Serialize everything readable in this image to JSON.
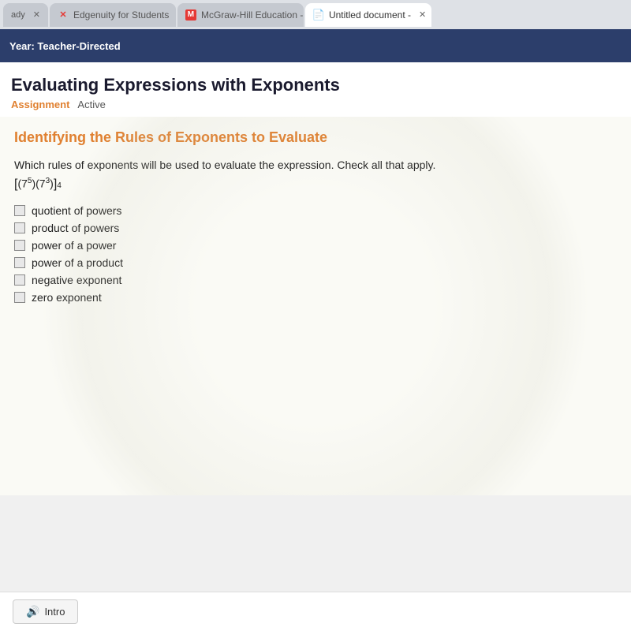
{
  "browser": {
    "tabs": [
      {
        "id": "tab-edgy",
        "label": "Edgenuity for Students",
        "icon_type": "edgenuity",
        "icon_text": "✕",
        "active": false
      },
      {
        "id": "tab-mcgraw",
        "label": "McGraw-Hill Education - L",
        "icon_type": "mcgraw",
        "icon_text": "M",
        "active": false
      },
      {
        "id": "tab-docs",
        "label": "Untitled document -",
        "icon_type": "docs",
        "icon_text": "≡",
        "active": true
      }
    ]
  },
  "navbar": {
    "text": "Year: Teacher-Directed"
  },
  "page": {
    "title": "Evaluating Expressions with Exponents",
    "meta": {
      "assignment_label": "Assignment",
      "status_label": "Active"
    }
  },
  "content": {
    "section_title": "Identifying the Rules of Exponents to Evaluate",
    "question": "Which rules of exponents will be used to evaluate the expression. Check all that apply.",
    "expression_text": "[(7⁵)(7³)]⁴",
    "checkboxes": [
      {
        "id": "cb1",
        "label": "quotient of powers",
        "checked": false
      },
      {
        "id": "cb2",
        "label": "product of powers",
        "checked": false
      },
      {
        "id": "cb3",
        "label": "power of a power",
        "checked": false
      },
      {
        "id": "cb4",
        "label": "power of a product",
        "checked": false
      },
      {
        "id": "cb5",
        "label": "negative exponent",
        "checked": false
      },
      {
        "id": "cb6",
        "label": "zero exponent",
        "checked": false
      }
    ]
  },
  "bottom": {
    "intro_button_label": "Intro"
  },
  "colors": {
    "nav_bg": "#2c3e6b",
    "accent_orange": "#e08030",
    "title_dark": "#1a1a2e"
  }
}
